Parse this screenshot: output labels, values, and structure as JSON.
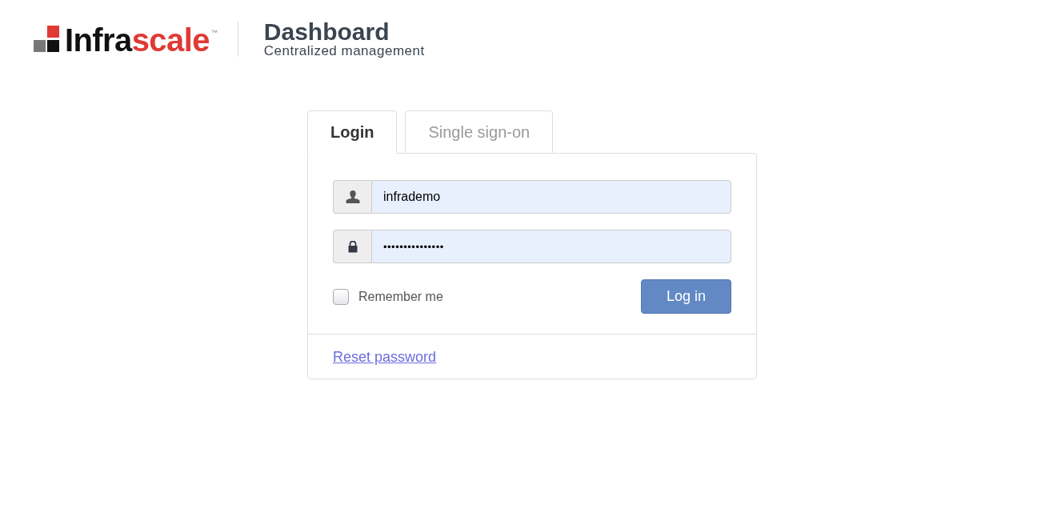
{
  "header": {
    "logo": {
      "text_dark": "Infra",
      "text_accent": "scale",
      "trademark": "™"
    },
    "title": "Dashboard",
    "subtitle": "Centralized management"
  },
  "tabs": [
    {
      "label": "Login",
      "selected": true
    },
    {
      "label": "Single sign-on",
      "selected": false
    }
  ],
  "form": {
    "fields": [
      {
        "kind": "user",
        "value": "infrademo"
      },
      {
        "kind": "password",
        "value": "•••••••••••••••"
      }
    ],
    "remember": {
      "label": "Remember me",
      "checked": false
    },
    "submit": "Log in"
  },
  "footer": {
    "link": "Reset password"
  }
}
